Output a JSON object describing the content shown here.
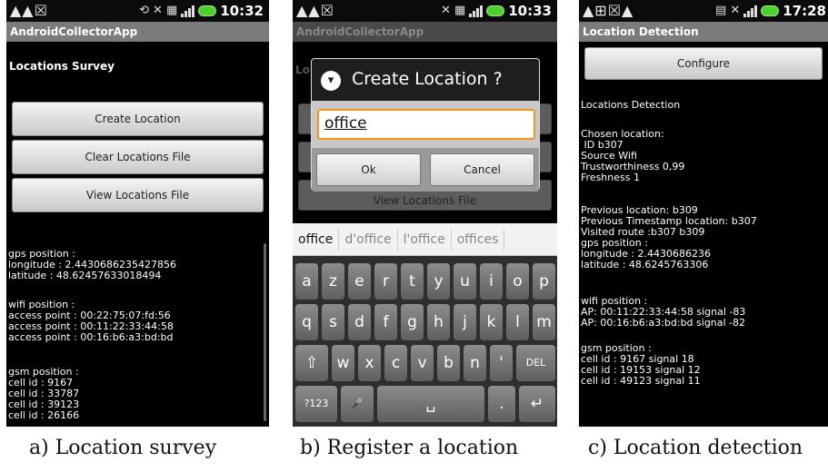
{
  "panel_a": {
    "status": {
      "left_icons": "▲▲☒",
      "time": "10:32"
    },
    "title": "AndroidCollectorApp",
    "heading": "Locations Survey",
    "buttons": [
      "Create Location",
      "Clear Locations File",
      "View Locations File"
    ],
    "gps_block": "gps position :\nlongitude : 2.4430686235427856\nlatitude : 48.62457633018494",
    "wifi_block": "wifi position :\naccess point : 00:22:75:07:fd:56\naccess point : 00:11:22:33:44:58\naccess point : 00:16:b6:a3:bd:bd",
    "gsm_block": "gsm position :\ncell id : 9167\ncell id : 33787\ncell id : 39123\ncell id : 26166",
    "caption": "a) Location survey"
  },
  "panel_b": {
    "status": {
      "left_icons": "▲▲☒",
      "time": "10:33"
    },
    "title": "AndroidCollectorApp",
    "heading_fragment": "Lo",
    "background_button": "View Locations File",
    "dialog": {
      "title": "Create Location ?",
      "input_value": "office",
      "ok_label": "Ok",
      "cancel_label": "Cancel"
    },
    "suggestions": [
      "office",
      "d'office",
      "l'office",
      "offices"
    ],
    "keyboard": {
      "row1": [
        "a",
        "z",
        "e",
        "r",
        "t",
        "y",
        "u",
        "i",
        "o",
        "p"
      ],
      "row2": [
        "q",
        "s",
        "d",
        "f",
        "g",
        "h",
        "j",
        "k",
        "l",
        "m"
      ],
      "row3": [
        "w",
        "x",
        "c",
        "v",
        "b",
        "n",
        "'"
      ],
      "shift": "⇧",
      "del": "DEL",
      "sym": "?123",
      "mic": "🎤",
      "space": "␣",
      "period": ".",
      "enter": "↵"
    },
    "caption": "b) Register a location"
  },
  "panel_c": {
    "status": {
      "left_icons": "▲⊞☒▲",
      "time": "17:28"
    },
    "title": "Location Detection",
    "configure_label": "Configure",
    "heading": "Locations Detection",
    "chosen_block": "Chosen location:\n ID b307\nSource Wifi\nTrustworthiness 0,99\nFreshness 1",
    "previous_block": "Previous location: b309\nPrevious Timestamp location: b307\nVisited route :b307 b309\ngps position :\nlongitude : 2.4430686236\nlatitude : 48.6245763306",
    "wifi_block": "wifi position :\nAP: 00:11:22:33:44:58 signal -83\nAP: 00:16:b6:a3:bd:bd signal -82",
    "gsm_block": "gsm position :\ncell id : 9167 signal 18\ncell id : 19153 signal 12\ncell id : 49123 signal 11",
    "caption": "c) Location detection"
  }
}
